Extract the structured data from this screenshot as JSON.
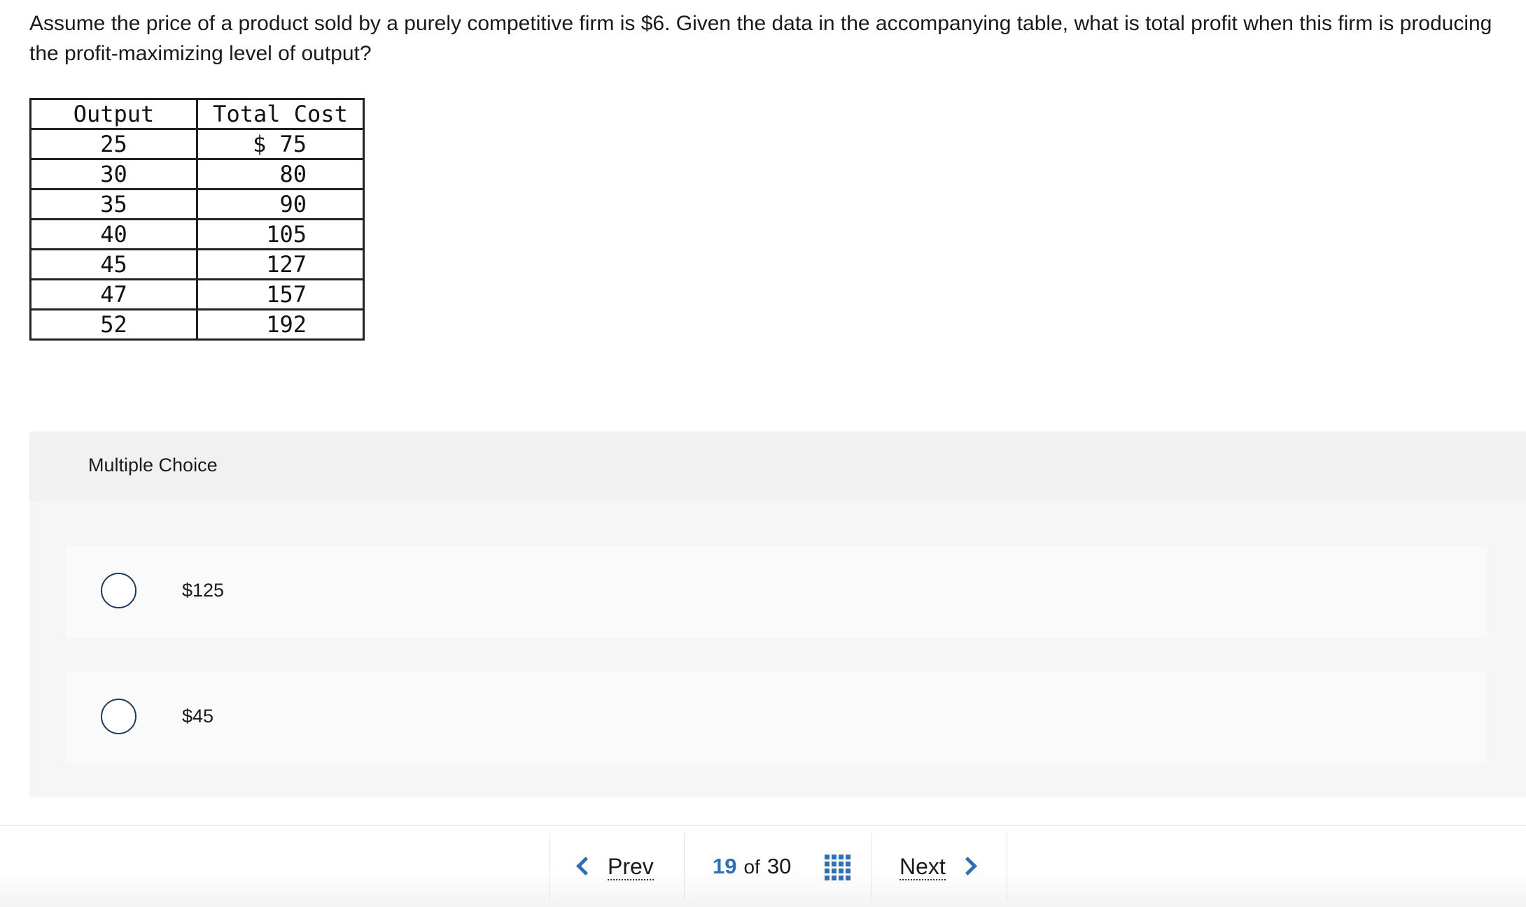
{
  "question": {
    "text": "Assume the price of a product sold by a purely competitive firm is $6. Given the data in the accompanying table, what is total profit when this firm is producing the profit-maximizing level of output?"
  },
  "table": {
    "headers": [
      "Output",
      "Total Cost"
    ],
    "rows": [
      [
        "25",
        "$ 75"
      ],
      [
        "30",
        "80"
      ],
      [
        "35",
        "90"
      ],
      [
        "40",
        "105"
      ],
      [
        "45",
        "127"
      ],
      [
        "47",
        "157"
      ],
      [
        "52",
        "192"
      ]
    ]
  },
  "multiple_choice": {
    "label": "Multiple Choice",
    "options": [
      {
        "label": "$125"
      },
      {
        "label": "$45"
      }
    ]
  },
  "nav": {
    "prev_label": "Prev",
    "next_label": "Next",
    "current_page": "19",
    "of_label": "of",
    "total_pages": "30",
    "grid_icon": "grid-icon",
    "accent_color": "#2f6fb5"
  }
}
